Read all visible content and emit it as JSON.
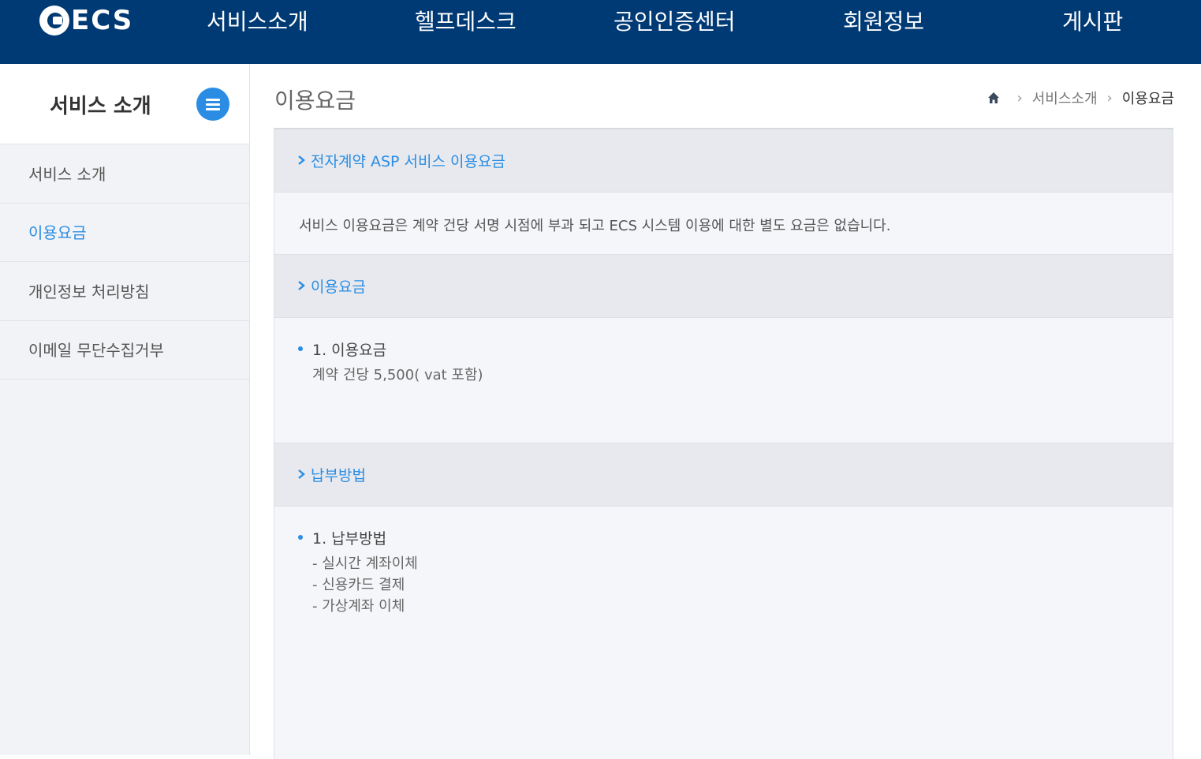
{
  "header": {
    "logo_text": "ECS",
    "nav": [
      "서비스소개",
      "헬프데스크",
      "공인인증센터",
      "회원정보",
      "게시판"
    ]
  },
  "sidebar": {
    "title": "서비스 소개",
    "items": [
      {
        "label": "서비스 소개",
        "active": false
      },
      {
        "label": "이용요금",
        "active": true
      },
      {
        "label": "개인정보 처리방침",
        "active": false
      },
      {
        "label": "이메일 무단수집거부",
        "active": false
      }
    ]
  },
  "main": {
    "page_title": "이용요금",
    "breadcrumb": {
      "parent": "서비스소개",
      "current": "이용요금"
    },
    "sections": [
      {
        "title": "전자계약 ASP 서비스 이용요금",
        "text": "서비스 이용요금은 계약 건당 서명 시점에 부과 되고 ECS 시스템 이용에 대한 별도 요금은 없습니다."
      },
      {
        "title": "이용요금",
        "item_title": "1. 이용요금",
        "lines": [
          "계약 건당 5,500( vat 포함)"
        ]
      },
      {
        "title": "납부방법",
        "item_title": "1. 납부방법",
        "lines": [
          "- 실시간 계좌이체",
          "- 신용카드 결제",
          "- 가상계좌 이체"
        ]
      }
    ]
  },
  "colors": {
    "header_bg": "#003a75",
    "accent": "#2a8de3"
  }
}
